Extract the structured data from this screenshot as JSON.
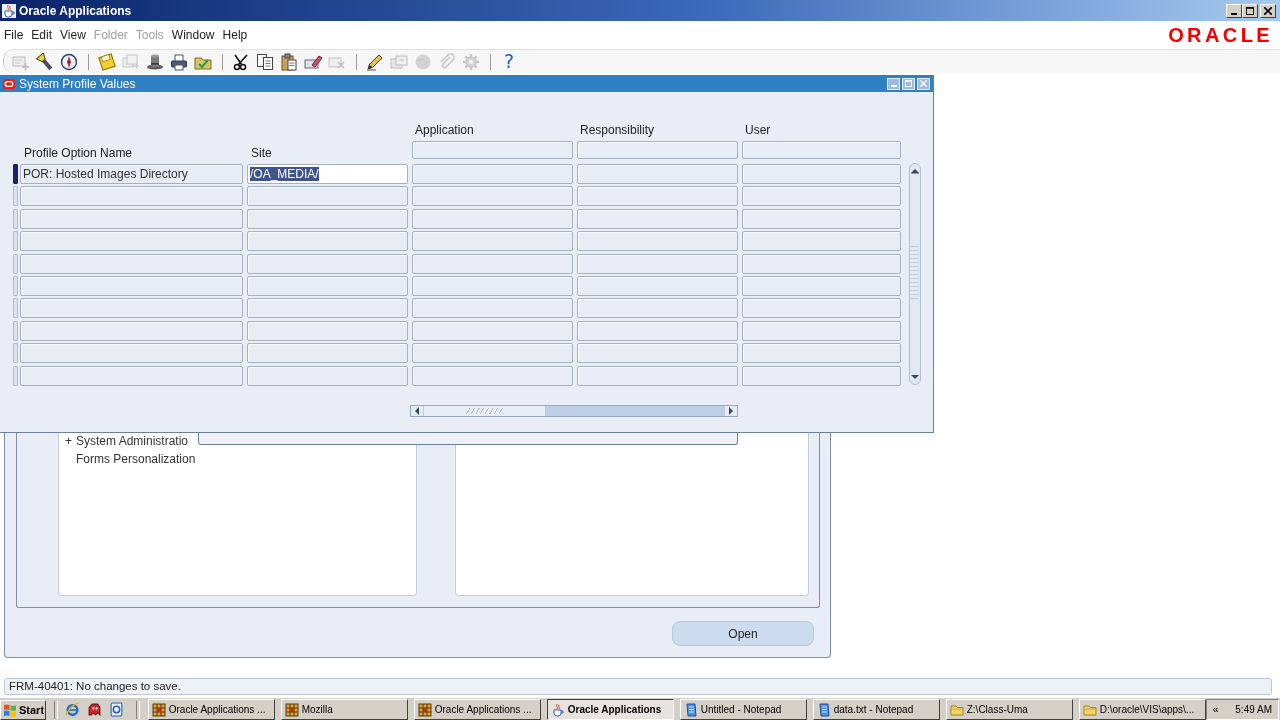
{
  "window": {
    "title": "Oracle Applications"
  },
  "menu": [
    {
      "label": "File",
      "disabled": false
    },
    {
      "label": "Edit",
      "disabled": false
    },
    {
      "label": "View",
      "disabled": false
    },
    {
      "label": "Folder",
      "disabled": true
    },
    {
      "label": "Tools",
      "disabled": true
    },
    {
      "label": "Window",
      "disabled": false
    },
    {
      "label": "Help",
      "disabled": false
    }
  ],
  "logo": "ORACLE",
  "toolbar": [
    {
      "tools": [
        {
          "kind": "new",
          "disabled": true
        },
        {
          "kind": "find",
          "disabled": false
        },
        {
          "kind": "navigator",
          "disabled": false
        }
      ]
    },
    {
      "tools": [
        {
          "kind": "save",
          "disabled": false
        },
        {
          "kind": "nextstep",
          "disabled": true
        },
        {
          "kind": "responsibility",
          "disabled": false
        },
        {
          "kind": "print",
          "disabled": false
        },
        {
          "kind": "closeform",
          "disabled": false
        }
      ]
    },
    {
      "tools": [
        {
          "kind": "cut",
          "disabled": false
        },
        {
          "kind": "copy",
          "disabled": false
        },
        {
          "kind": "paste",
          "disabled": false
        },
        {
          "kind": "clear",
          "disabled": false
        },
        {
          "kind": "delete",
          "disabled": true
        }
      ]
    },
    {
      "tools": [
        {
          "kind": "edit",
          "disabled": false
        },
        {
          "kind": "zoom",
          "disabled": true
        },
        {
          "kind": "translate",
          "disabled": true
        },
        {
          "kind": "attach",
          "disabled": true
        },
        {
          "kind": "foldertools",
          "disabled": true
        }
      ]
    },
    {
      "tools": [
        {
          "kind": "help",
          "label": "?",
          "disabled": false
        }
      ]
    }
  ],
  "profile_window": {
    "title": "System Profile Values",
    "columns": [
      {
        "label": "Profile Option Name",
        "kind": "name"
      },
      {
        "label": "Site",
        "kind": "site"
      },
      {
        "label": "Application",
        "kind": "level"
      },
      {
        "label": "Responsibility",
        "kind": "level"
      },
      {
        "label": "User",
        "kind": "level"
      }
    ],
    "rows": [
      {
        "selected": true,
        "values": [
          "POR: Hosted Images Directory",
          "/OA_MEDIA/"
        ],
        "site_focused": true
      },
      {
        "selected": false,
        "site_focused": false
      },
      {
        "selected": false,
        "site_focused": false
      },
      {
        "selected": false,
        "site_focused": false
      },
      {
        "selected": false,
        "site_focused": false
      },
      {
        "selected": false,
        "site_focused": false
      },
      {
        "selected": false,
        "site_focused": false
      },
      {
        "selected": false,
        "site_focused": false
      },
      {
        "selected": false,
        "site_focused": false
      },
      {
        "selected": false,
        "site_focused": false
      }
    ]
  },
  "navigator": {
    "tree": [
      {
        "expander": "+",
        "label": "System Administratio"
      },
      {
        "label": "Forms Personalization"
      }
    ],
    "open_button": "Open"
  },
  "status": "FRM-40401: No changes to save.",
  "taskbar": {
    "start": "Start",
    "tasks": [
      {
        "label": "Oracle Applications ...",
        "kind": "forms",
        "selected": false
      },
      {
        "label": "Mozilla",
        "kind": "forms",
        "selected": false
      },
      {
        "label": "Oracle Applications ...",
        "kind": "forms",
        "selected": false
      },
      {
        "label": "Oracle Applications",
        "kind": "java",
        "selected": true
      },
      {
        "label": "Untitled - Notepad",
        "kind": "notepad",
        "selected": false
      },
      {
        "label": "data.txt - Notepad",
        "kind": "notepad",
        "selected": false
      },
      {
        "label": "Z:\\Class-Uma",
        "kind": "folder",
        "selected": false
      },
      {
        "label": "D:\\oracle\\VIS\\apps\\...",
        "kind": "folder",
        "selected": false
      }
    ],
    "tray": {
      "chevron": "«",
      "clock": "5:49 AM"
    }
  }
}
